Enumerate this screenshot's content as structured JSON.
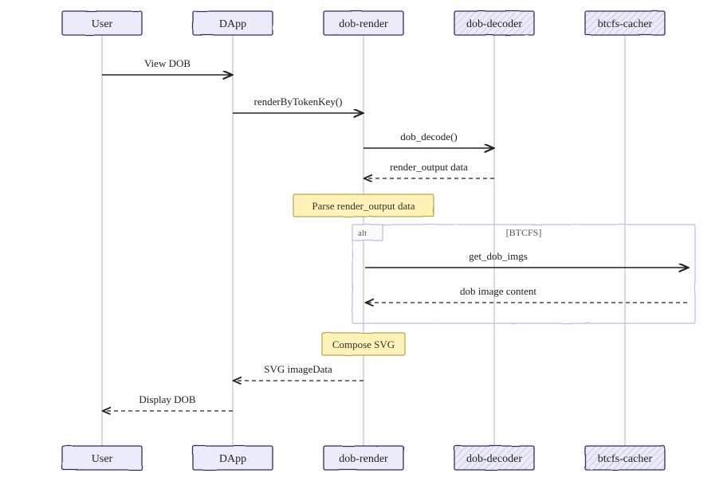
{
  "participants": [
    {
      "id": "user",
      "label": "User",
      "hatched": false
    },
    {
      "id": "dapp",
      "label": "DApp",
      "hatched": false
    },
    {
      "id": "render",
      "label": "dob-render",
      "hatched": false
    },
    {
      "id": "decoder",
      "label": "dob-decoder",
      "hatched": true
    },
    {
      "id": "cacher",
      "label": "btcfs-cacher",
      "hatched": true
    }
  ],
  "messages": {
    "m1": "View DOB",
    "m2": "renderByTokenKey()",
    "m3": "dob_decode()",
    "m4": "render_output data",
    "m5": "get_dob_imgs",
    "m6": "dob image content",
    "m7": "SVG imageData",
    "m8": "Display DOB"
  },
  "notes": {
    "n1": "Parse render_output data",
    "n2": "Compose SVG"
  },
  "alt": {
    "label": "alt",
    "condition": "[BTCFS]"
  }
}
